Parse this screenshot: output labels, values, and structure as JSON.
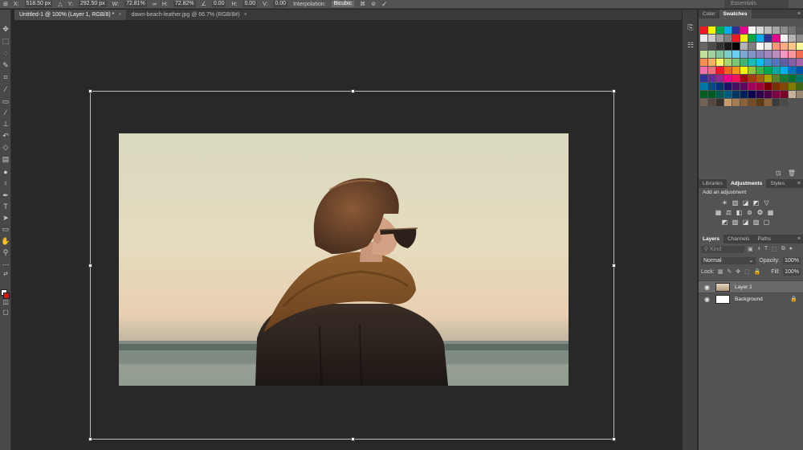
{
  "options_bar": {
    "x_label": "X:",
    "x_value": "518.50 px",
    "y_label": "Y:",
    "y_value": "292.50 px",
    "w_label": "W:",
    "w_value": "72.81%",
    "h_label": "H:",
    "h_value": "72.82%",
    "angle_value": "0.00",
    "hskew_label": "H:",
    "hskew_value": "0.00",
    "vskew_label": "V:",
    "vskew_value": "0.00",
    "interp_label": "Interpolation:",
    "interp_value": "Bicubic",
    "workspace": "Essentials"
  },
  "tabs": [
    {
      "label": "Untitled-1 @ 100% (Layer 1, RGB/8) *",
      "close": "×"
    },
    {
      "label": "dawn-beach-leather.jpg @ 66.7% (RGB/8#)",
      "close": "×"
    }
  ],
  "panels": {
    "color_tabs": [
      "Color",
      "Swatches"
    ],
    "adj_tabs": [
      "Libraries",
      "Adjustments",
      "Styles"
    ],
    "add_adjustment": "Add an adjustment",
    "layer_tabs": [
      "Layers",
      "Channels",
      "Paths"
    ],
    "kind_placeholder": "Kind",
    "blend_mode": "Normal",
    "opacity_label": "Opacity:",
    "opacity_value": "100%",
    "lock_label": "Lock:",
    "fill_label": "Fill:",
    "fill_value": "100%",
    "layers": [
      {
        "name": "Layer 1"
      },
      {
        "name": "Background"
      }
    ]
  },
  "colors": {
    "foreground": "#ffffff",
    "background": "#d0151c",
    "swatches": [
      "#ed1c24",
      "#fff200",
      "#00a651",
      "#00aeef",
      "#2e3192",
      "#ec008c",
      "#ffffff",
      "#d9d9d9",
      "#bfbfbf",
      "#a6a6a6",
      "#8c8c8c",
      "#737373",
      "#595959",
      "#ebebeb",
      "#cccccc",
      "#9e9e9e",
      "#7f7f7f",
      "#ed1c24",
      "#fff200",
      "#00a651",
      "#00aeef",
      "#2e3192",
      "#ec008c",
      "#f2f2f2",
      "#b3b3b3",
      "#8c8c8c",
      "#666666",
      "#4d4d4d",
      "#333333",
      "#1a1a1a",
      "#000000",
      "#b3b3b3",
      "#808080",
      "#ffffff",
      "#e6e6e6",
      "#f7977a",
      "#f9ad81",
      "#fdc68a",
      "#fff79a",
      "#c4df9b",
      "#a2d39c",
      "#82ca9d",
      "#7bcdc8",
      "#6ecff6",
      "#7ea7d8",
      "#8493ca",
      "#8882be",
      "#a187be",
      "#bc8dbf",
      "#f49ac2",
      "#f6989d",
      "#f26c4f",
      "#f68e55",
      "#fbaf5c",
      "#fff467",
      "#acd372",
      "#7cc576",
      "#3bb878",
      "#1abbb4",
      "#00bff3",
      "#438ccb",
      "#5574b9",
      "#605ca8",
      "#855fa8",
      "#a763a8",
      "#f06ea9",
      "#f26d7d",
      "#ed1c24",
      "#f26522",
      "#f7941d",
      "#fff200",
      "#8dc63f",
      "#39b54a",
      "#00a651",
      "#00a99d",
      "#00aeef",
      "#0072bc",
      "#0054a6",
      "#2e3192",
      "#662d91",
      "#92278f",
      "#ec008c",
      "#ed145b",
      "#9e0b0f",
      "#a0410d",
      "#a36209",
      "#aba000",
      "#598527",
      "#197b30",
      "#007236",
      "#00746b",
      "#0076a3",
      "#004b80",
      "#003471",
      "#1b1464",
      "#440e62",
      "#630460",
      "#9e005d",
      "#9e0039",
      "#790000",
      "#7b2e00",
      "#7d4900",
      "#827b00",
      "#406618",
      "#005e20",
      "#005826",
      "#005952",
      "#005b7f",
      "#003663",
      "#002157",
      "#0d004c",
      "#32004b",
      "#4b0049",
      "#7b0046",
      "#7a0026",
      "#c7b299",
      "#998675",
      "#736357",
      "#534741",
      "#37302d",
      "#c69c6d",
      "#a67c52",
      "#8c6239",
      "#754c24",
      "#603913",
      "#8c6239",
      "#3c3c3c",
      "#4a4a4a"
    ],
    "selected_layer": "#696969"
  },
  "icons": {
    "tools": [
      "move-icon",
      "marquee-icon",
      "lasso-icon",
      "quick-select-icon",
      "crop-icon",
      "eyedropper-icon",
      "healing-icon",
      "brush-icon",
      "stamp-icon",
      "history-brush-icon",
      "eraser-icon",
      "gradient-icon",
      "blur-icon",
      "dodge-icon",
      "pen-icon",
      "type-icon",
      "path-select-icon",
      "rectangle-icon",
      "hand-icon",
      "zoom-icon",
      "more-icon"
    ]
  }
}
